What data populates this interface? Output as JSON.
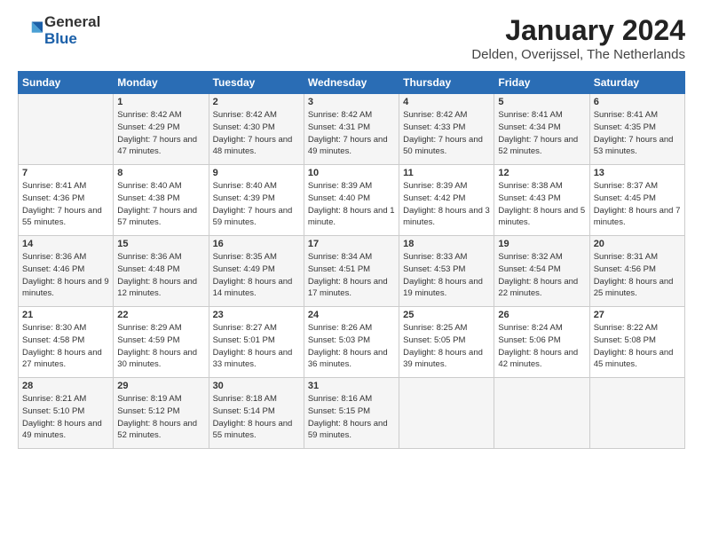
{
  "header": {
    "logo_general": "General",
    "logo_blue": "Blue",
    "title": "January 2024",
    "location": "Delden, Overijssel, The Netherlands"
  },
  "weekdays": [
    "Sunday",
    "Monday",
    "Tuesday",
    "Wednesday",
    "Thursday",
    "Friday",
    "Saturday"
  ],
  "weeks": [
    [
      {
        "day": "",
        "sunrise": "",
        "sunset": "",
        "daylight": ""
      },
      {
        "day": "1",
        "sunrise": "Sunrise: 8:42 AM",
        "sunset": "Sunset: 4:29 PM",
        "daylight": "Daylight: 7 hours and 47 minutes."
      },
      {
        "day": "2",
        "sunrise": "Sunrise: 8:42 AM",
        "sunset": "Sunset: 4:30 PM",
        "daylight": "Daylight: 7 hours and 48 minutes."
      },
      {
        "day": "3",
        "sunrise": "Sunrise: 8:42 AM",
        "sunset": "Sunset: 4:31 PM",
        "daylight": "Daylight: 7 hours and 49 minutes."
      },
      {
        "day": "4",
        "sunrise": "Sunrise: 8:42 AM",
        "sunset": "Sunset: 4:33 PM",
        "daylight": "Daylight: 7 hours and 50 minutes."
      },
      {
        "day": "5",
        "sunrise": "Sunrise: 8:41 AM",
        "sunset": "Sunset: 4:34 PM",
        "daylight": "Daylight: 7 hours and 52 minutes."
      },
      {
        "day": "6",
        "sunrise": "Sunrise: 8:41 AM",
        "sunset": "Sunset: 4:35 PM",
        "daylight": "Daylight: 7 hours and 53 minutes."
      }
    ],
    [
      {
        "day": "7",
        "sunrise": "Sunrise: 8:41 AM",
        "sunset": "Sunset: 4:36 PM",
        "daylight": "Daylight: 7 hours and 55 minutes."
      },
      {
        "day": "8",
        "sunrise": "Sunrise: 8:40 AM",
        "sunset": "Sunset: 4:38 PM",
        "daylight": "Daylight: 7 hours and 57 minutes."
      },
      {
        "day": "9",
        "sunrise": "Sunrise: 8:40 AM",
        "sunset": "Sunset: 4:39 PM",
        "daylight": "Daylight: 7 hours and 59 minutes."
      },
      {
        "day": "10",
        "sunrise": "Sunrise: 8:39 AM",
        "sunset": "Sunset: 4:40 PM",
        "daylight": "Daylight: 8 hours and 1 minute."
      },
      {
        "day": "11",
        "sunrise": "Sunrise: 8:39 AM",
        "sunset": "Sunset: 4:42 PM",
        "daylight": "Daylight: 8 hours and 3 minutes."
      },
      {
        "day": "12",
        "sunrise": "Sunrise: 8:38 AM",
        "sunset": "Sunset: 4:43 PM",
        "daylight": "Daylight: 8 hours and 5 minutes."
      },
      {
        "day": "13",
        "sunrise": "Sunrise: 8:37 AM",
        "sunset": "Sunset: 4:45 PM",
        "daylight": "Daylight: 8 hours and 7 minutes."
      }
    ],
    [
      {
        "day": "14",
        "sunrise": "Sunrise: 8:36 AM",
        "sunset": "Sunset: 4:46 PM",
        "daylight": "Daylight: 8 hours and 9 minutes."
      },
      {
        "day": "15",
        "sunrise": "Sunrise: 8:36 AM",
        "sunset": "Sunset: 4:48 PM",
        "daylight": "Daylight: 8 hours and 12 minutes."
      },
      {
        "day": "16",
        "sunrise": "Sunrise: 8:35 AM",
        "sunset": "Sunset: 4:49 PM",
        "daylight": "Daylight: 8 hours and 14 minutes."
      },
      {
        "day": "17",
        "sunrise": "Sunrise: 8:34 AM",
        "sunset": "Sunset: 4:51 PM",
        "daylight": "Daylight: 8 hours and 17 minutes."
      },
      {
        "day": "18",
        "sunrise": "Sunrise: 8:33 AM",
        "sunset": "Sunset: 4:53 PM",
        "daylight": "Daylight: 8 hours and 19 minutes."
      },
      {
        "day": "19",
        "sunrise": "Sunrise: 8:32 AM",
        "sunset": "Sunset: 4:54 PM",
        "daylight": "Daylight: 8 hours and 22 minutes."
      },
      {
        "day": "20",
        "sunrise": "Sunrise: 8:31 AM",
        "sunset": "Sunset: 4:56 PM",
        "daylight": "Daylight: 8 hours and 25 minutes."
      }
    ],
    [
      {
        "day": "21",
        "sunrise": "Sunrise: 8:30 AM",
        "sunset": "Sunset: 4:58 PM",
        "daylight": "Daylight: 8 hours and 27 minutes."
      },
      {
        "day": "22",
        "sunrise": "Sunrise: 8:29 AM",
        "sunset": "Sunset: 4:59 PM",
        "daylight": "Daylight: 8 hours and 30 minutes."
      },
      {
        "day": "23",
        "sunrise": "Sunrise: 8:27 AM",
        "sunset": "Sunset: 5:01 PM",
        "daylight": "Daylight: 8 hours and 33 minutes."
      },
      {
        "day": "24",
        "sunrise": "Sunrise: 8:26 AM",
        "sunset": "Sunset: 5:03 PM",
        "daylight": "Daylight: 8 hours and 36 minutes."
      },
      {
        "day": "25",
        "sunrise": "Sunrise: 8:25 AM",
        "sunset": "Sunset: 5:05 PM",
        "daylight": "Daylight: 8 hours and 39 minutes."
      },
      {
        "day": "26",
        "sunrise": "Sunrise: 8:24 AM",
        "sunset": "Sunset: 5:06 PM",
        "daylight": "Daylight: 8 hours and 42 minutes."
      },
      {
        "day": "27",
        "sunrise": "Sunrise: 8:22 AM",
        "sunset": "Sunset: 5:08 PM",
        "daylight": "Daylight: 8 hours and 45 minutes."
      }
    ],
    [
      {
        "day": "28",
        "sunrise": "Sunrise: 8:21 AM",
        "sunset": "Sunset: 5:10 PM",
        "daylight": "Daylight: 8 hours and 49 minutes."
      },
      {
        "day": "29",
        "sunrise": "Sunrise: 8:19 AM",
        "sunset": "Sunset: 5:12 PM",
        "daylight": "Daylight: 8 hours and 52 minutes."
      },
      {
        "day": "30",
        "sunrise": "Sunrise: 8:18 AM",
        "sunset": "Sunset: 5:14 PM",
        "daylight": "Daylight: 8 hours and 55 minutes."
      },
      {
        "day": "31",
        "sunrise": "Sunrise: 8:16 AM",
        "sunset": "Sunset: 5:15 PM",
        "daylight": "Daylight: 8 hours and 59 minutes."
      },
      {
        "day": "",
        "sunrise": "",
        "sunset": "",
        "daylight": ""
      },
      {
        "day": "",
        "sunrise": "",
        "sunset": "",
        "daylight": ""
      },
      {
        "day": "",
        "sunrise": "",
        "sunset": "",
        "daylight": ""
      }
    ]
  ]
}
